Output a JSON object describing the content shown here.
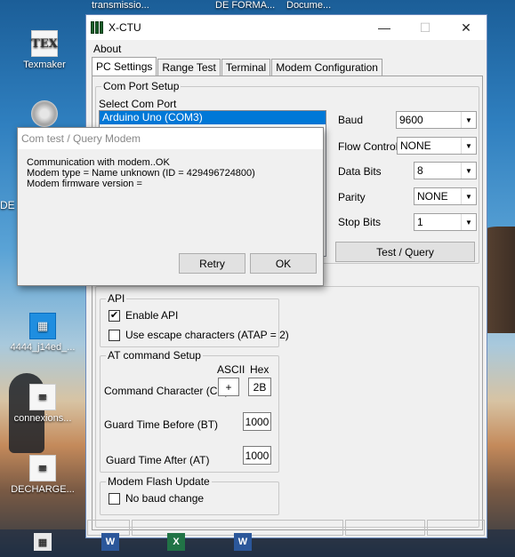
{
  "desktop": {
    "top_files": [
      "transmissio...",
      "DE FORMA...",
      "Docume..."
    ],
    "icons": [
      "Texmaker",
      "4444_j14ed_...",
      "connexions...",
      "DECHARGE..."
    ],
    "left_edge_text": "DE"
  },
  "window": {
    "title": "X-CTU",
    "controls": {
      "minimize": "—",
      "maximize": "☐",
      "close": "✕"
    },
    "menu": {
      "about": "About"
    },
    "tabs": [
      "PC Settings",
      "Range Test",
      "Terminal",
      "Modem Configuration"
    ],
    "com_port_setup": {
      "group_label": "Com Port Setup",
      "select_label": "Select Com Port",
      "selected_port": "Arduino Uno (COM3)",
      "baud_label": "Baud",
      "baud_value": "9600",
      "flow_label": "Flow Control",
      "flow_value": "NONE",
      "data_bits_label": "Data Bits",
      "data_bits_value": "8",
      "parity_label": "Parity",
      "parity_value": "NONE",
      "stop_bits_label": "Stop Bits",
      "stop_bits_value": "1",
      "test_button": "Test / Query"
    },
    "api": {
      "group_label": "API",
      "enable_api": "Enable API",
      "enable_api_checked": true,
      "escape_chars": "Use escape characters (ATAP = 2)",
      "escape_checked": false
    },
    "at_command": {
      "group_label": "AT command Setup",
      "ascii_header": "ASCII",
      "hex_header": "Hex",
      "cc_label": "Command Character (CC)",
      "cc_ascii": "+",
      "cc_hex": "2B",
      "bt_label": "Guard Time Before (BT)",
      "bt_value": "1000",
      "at_label": "Guard Time After (AT)",
      "at_value": "1000"
    },
    "flash": {
      "group_label": "Modem Flash Update",
      "no_baud_change": "No baud change",
      "checked": false
    }
  },
  "dialog": {
    "title": "Com test / Query Modem",
    "lines": [
      "Communication with modem..OK",
      "Modem type = Name unknown (ID = 429496724800)",
      "Modem firmware version ="
    ],
    "retry": "Retry",
    "ok": "OK"
  },
  "taskbar": {
    "icons": [
      "word-doc-icon",
      "excel-doc-icon",
      "word-doc-icon"
    ]
  },
  "colors": {
    "selection": "#0078d7",
    "window_bg": "#f0f0f0"
  }
}
